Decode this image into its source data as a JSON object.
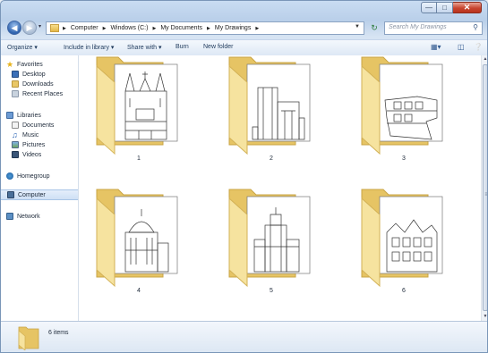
{
  "address": {
    "crumbs": [
      "Computer",
      "Windows (C:)",
      "My Documents",
      "My Drawings"
    ]
  },
  "search": {
    "placeholder": "Search My Drawings"
  },
  "toolbar": {
    "organize": "Organize ▾",
    "include": "Include in library ▾",
    "share": "Share with ▾",
    "burn": "Burn",
    "new_folder": "New folder"
  },
  "nav": {
    "favorites": "Favorites",
    "desktop": "Desktop",
    "downloads": "Downloads",
    "recent_places": "Recent Places",
    "libraries": "Libraries",
    "documents": "Documents",
    "music": "Music",
    "pictures": "Pictures",
    "videos": "Videos",
    "homegroup": "Homegroup",
    "computer": "Computer",
    "network": "Network"
  },
  "folders": [
    "1",
    "2",
    "3",
    "4",
    "5",
    "6"
  ],
  "status": {
    "item_count": "6 items"
  },
  "colors": {
    "folder_back": "#f1d67f",
    "folder_front": "#f6e39f",
    "accent": "#2f63ae",
    "close": "#c7452f"
  },
  "icons": {
    "back": "back-arrow-icon",
    "forward": "forward-arrow-icon",
    "refresh": "refresh-icon",
    "search": "search-icon",
    "views": "view-options-icon",
    "preview": "preview-pane-icon",
    "help": "help-icon"
  }
}
